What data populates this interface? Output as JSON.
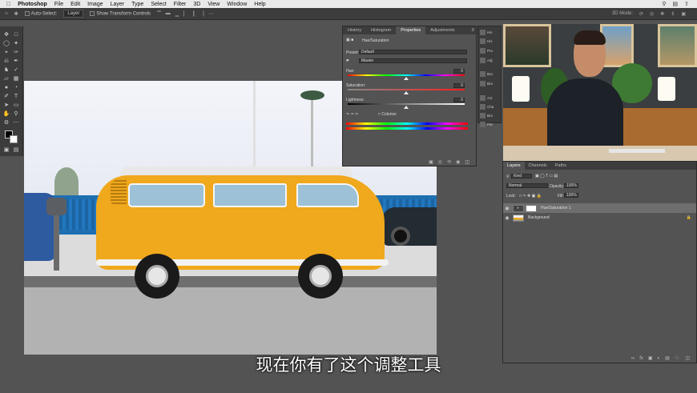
{
  "menubar": {
    "apple_icon": "apple-icon",
    "app_name": "Photoshop",
    "items": [
      "File",
      "Edit",
      "Image",
      "Layer",
      "Type",
      "Select",
      "Filter",
      "3D",
      "View",
      "Window",
      "Help"
    ]
  },
  "options_bar": {
    "auto_select_label": "Auto-Select:",
    "auto_select_value": "Layer",
    "transform_controls_label": "Show Transform Controls",
    "mode_label": "3D Mode:"
  },
  "properties_panel": {
    "tabs": [
      "History",
      "Histogram",
      "Properties",
      "Adjustments"
    ],
    "active_tab": "Properties",
    "adjustment_name": "Hue/Saturation",
    "preset_label": "Preset:",
    "preset_value": "Default",
    "channel_value": "Master",
    "hue_label": "Hue:",
    "hue_value": "0",
    "saturation_label": "Saturation:",
    "saturation_value": "0",
    "lightness_label": "Lightness:",
    "lightness_value": "0",
    "colorize_label": "Colorize"
  },
  "icon_strip": {
    "items": [
      "His",
      "His",
      "Pro",
      "Adj",
      "Bru",
      "Bru",
      "Act",
      "Cha",
      "Bru",
      "Par"
    ]
  },
  "layers_panel": {
    "tabs": [
      "Layers",
      "Channels",
      "Paths"
    ],
    "active_tab": "Layers",
    "kind_value": "Kind",
    "blend_mode": "Normal",
    "opacity_label": "Opacity:",
    "opacity_value": "100%",
    "lock_label": "Lock:",
    "fill_label": "Fill:",
    "fill_value": "100%",
    "layers": [
      {
        "name": "Hue/Saturation 1",
        "selected": true
      },
      {
        "name": "Background",
        "selected": false
      }
    ]
  },
  "subtitle": "现在你有了这个调整工具",
  "colors": {
    "menubar_bg": "#e9e9e9",
    "panel_bg": "#535353",
    "panel_dark": "#3c3c3c",
    "van_orange": "#f0a81c"
  }
}
